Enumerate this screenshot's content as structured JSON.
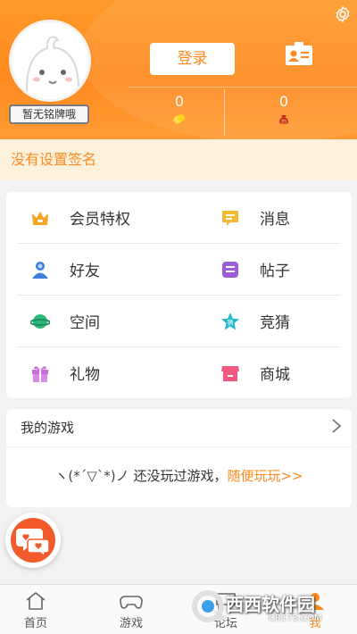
{
  "header": {
    "nameplate": "暂无铭牌哦",
    "login_label": "登录",
    "stats": [
      {
        "value": "0",
        "icon": "gold-coin-icon"
      },
      {
        "value": "0",
        "icon": "money-bag-icon"
      }
    ]
  },
  "signature": "没有设置签名",
  "menu": {
    "items": [
      {
        "label": "会员特权",
        "icon": "crown-icon",
        "color": "#f4a623"
      },
      {
        "label": "消息",
        "icon": "message-icon",
        "color": "#f4b833"
      },
      {
        "label": "好友",
        "icon": "friends-icon",
        "color": "#3b7fd8"
      },
      {
        "label": "帖子",
        "icon": "posts-icon",
        "color": "#9b5cd8"
      },
      {
        "label": "空间",
        "icon": "planet-icon",
        "color": "#2bb87a"
      },
      {
        "label": "竞猜",
        "icon": "guess-star-icon",
        "color": "#1fb7c9"
      },
      {
        "label": "礼物",
        "icon": "gift-icon",
        "color": "#c86ed8"
      },
      {
        "label": "商城",
        "icon": "shop-icon",
        "color": "#f05a82"
      }
    ]
  },
  "games": {
    "title": "我的游戏",
    "empty_face": "ヽ(*´▽`*)ノ",
    "empty_text": "还没玩过游戏，",
    "empty_link": "随便玩玩>>"
  },
  "tabbar": {
    "items": [
      {
        "label": "首页",
        "icon": "home-icon"
      },
      {
        "label": "游戏",
        "icon": "gamepad-icon"
      },
      {
        "label": "论坛",
        "icon": "forum-icon"
      },
      {
        "label": "我",
        "icon": "profile-icon",
        "active": true
      }
    ]
  },
  "watermark": {
    "brand": "西西软件园",
    "url": "CR173.COM"
  },
  "colors": {
    "accent": "#ff8a1f",
    "sign_bg": "#fdf1dc"
  }
}
